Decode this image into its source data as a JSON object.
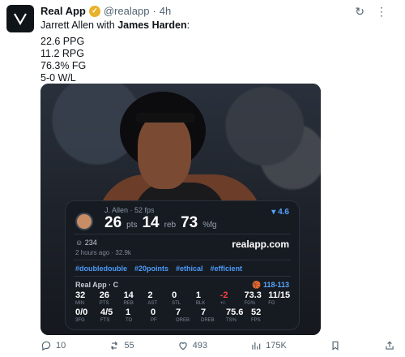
{
  "tweet": {
    "name": "Real App",
    "handle": "@realapp",
    "time": "4h",
    "text_prefix": "Jarrett Allen with ",
    "text_bold": "James Harden",
    "text_suffix": ":",
    "stats": [
      "22.6 PPG",
      "11.2 RPG",
      "76.3% FG",
      "5-0 W/L"
    ]
  },
  "card": {
    "player": "J. Allen · 52 fps",
    "pts": "26",
    "pts_unit": "pts",
    "reb": "14",
    "reb_unit": "reb",
    "fg": "73",
    "fg_unit": "%fg",
    "plus_minus": "4.6",
    "likes": "234",
    "timeline": "2 hours ago · 32.9k",
    "brand": "realapp.com",
    "tags": [
      "#doubledouble",
      "#20points",
      "#ethical",
      "#efficient"
    ],
    "team": "Real App · C",
    "score": "118-113",
    "row1": [
      {
        "v": "32",
        "l": "MIN"
      },
      {
        "v": "26",
        "l": "PTS"
      },
      {
        "v": "14",
        "l": "REB"
      },
      {
        "v": "2",
        "l": "AST"
      },
      {
        "v": "0",
        "l": "STL"
      },
      {
        "v": "1",
        "l": "BLK"
      },
      {
        "v": "-2",
        "l": "+/-"
      },
      {
        "v": "73.3",
        "l": "FG%"
      },
      {
        "v": "11/15",
        "l": "FG"
      }
    ],
    "row2": [
      {
        "v": "0/0",
        "l": "3FG"
      },
      {
        "v": "4/5",
        "l": "FTS"
      },
      {
        "v": "1",
        "l": "TO"
      },
      {
        "v": "0",
        "l": "PF"
      },
      {
        "v": "7",
        "l": "OREB"
      },
      {
        "v": "7",
        "l": "DREB"
      },
      {
        "v": "75.6",
        "l": "TS%"
      },
      {
        "v": "52",
        "l": "FPS"
      }
    ]
  },
  "actions": {
    "comments": "10",
    "reposts": "55",
    "likes": "493",
    "views": "175K"
  },
  "colors": {
    "accent_blue": "#4b9cff",
    "negative_red": "#ff4040",
    "verified_gold": "#e8b32a"
  }
}
